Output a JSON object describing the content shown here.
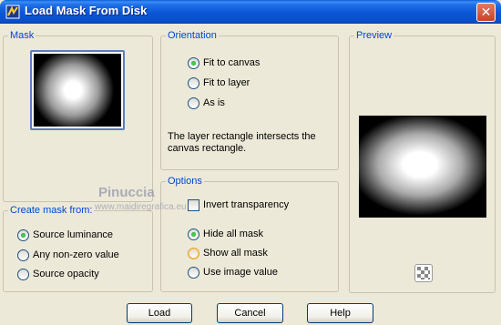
{
  "window": {
    "title": "Load Mask From Disk",
    "close_glyph": "✕"
  },
  "mask": {
    "legend": "Mask"
  },
  "orientation": {
    "legend": "Orientation",
    "options": [
      "Fit to canvas",
      "Fit to layer",
      "As is"
    ],
    "selected": "Fit to canvas",
    "description": "The layer rectangle intersects the canvas rectangle."
  },
  "preview": {
    "legend": "Preview",
    "toggle_icon": "checkerboard-icon"
  },
  "create_mask": {
    "legend": "Create mask from:",
    "options": [
      "Source luminance",
      "Any non-zero value",
      "Source opacity"
    ],
    "selected": "Source luminance"
  },
  "options": {
    "legend": "Options",
    "invert_label": "Invert transparency",
    "invert_checked": false,
    "mask_options": [
      "Hide all mask",
      "Show all mask",
      "Use image value"
    ],
    "selected": "Hide all mask"
  },
  "watermark": {
    "name": "Pinuccia",
    "url": "www.maidiregrafica.eu"
  },
  "buttons": {
    "load": "Load",
    "cancel": "Cancel",
    "help": "Help"
  },
  "colors": {
    "title_bar": "#0a56d6",
    "legend": "#0046d5",
    "dialog_bg": "#ece9d8"
  }
}
